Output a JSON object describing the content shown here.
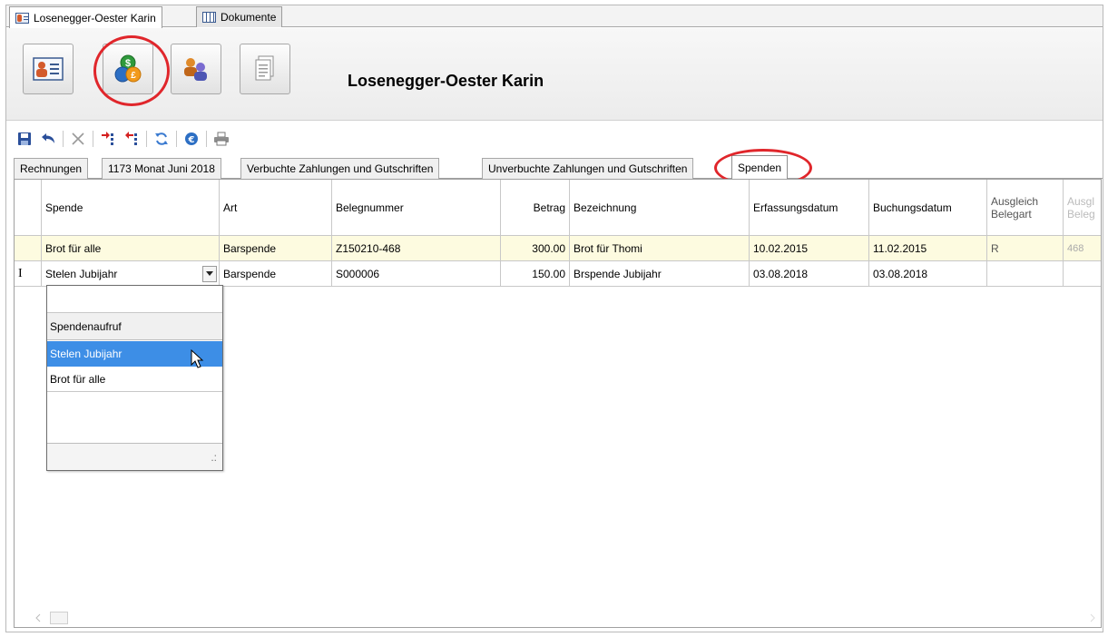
{
  "top_tabs": [
    {
      "label": "Losenegger-Oester Karin",
      "icon": "person-card-icon",
      "active": true
    },
    {
      "label": "Dokumente",
      "icon": "grid-icon",
      "active": false
    }
  ],
  "header": {
    "title": "Losenegger-Oester Karin",
    "buttons": [
      {
        "name": "person-details-button",
        "icon": "person-card-icon"
      },
      {
        "name": "finance-button",
        "icon": "money-bag-icon",
        "highlighted": true
      },
      {
        "name": "relations-button",
        "icon": "people-icon"
      },
      {
        "name": "documents-button",
        "icon": "document-icon"
      }
    ]
  },
  "toolbar": {
    "icons": [
      "save-icon",
      "undo-icon",
      "delete-icon",
      "move-up-icon",
      "move-down-icon",
      "refresh-icon",
      "euro-icon",
      "print-icon"
    ]
  },
  "sub_tabs": [
    {
      "label": "Rechnungen"
    },
    {
      "label": "1173 Monat Juni 2018"
    },
    {
      "label": "Verbuchte Zahlungen und Gutschriften"
    },
    {
      "label": "Unverbuchte Zahlungen und Gutschriften"
    },
    {
      "label": "Spenden",
      "active": true
    }
  ],
  "table": {
    "headers": {
      "spende": "Spende",
      "art": "Art",
      "belegnummer": "Belegnummer",
      "betrag": "Betrag",
      "bezeichnung": "Bezeichnung",
      "erfassungsdatum": "Erfassungsdatum",
      "buchungsdatum": "Buchungsdatum",
      "ausgleich_belegart_1": "Ausgleich",
      "ausgleich_belegart_2": "Belegart",
      "ausgleich_belegnr_1": "Ausgl",
      "ausgleich_belegnr_2": "Beleg"
    },
    "rows": [
      {
        "spende": "Brot für alle",
        "art": "Barspende",
        "belegnummer": "Z150210-468",
        "betrag": "300.00",
        "bezeichnung": "Brot für Thomi",
        "erfassungsdatum": "10.02.2015",
        "buchungsdatum": "11.02.2015",
        "ausgleich_belegart": "R",
        "ausgleich_belegnr": "468"
      },
      {
        "spende": "Stelen Jubijahr",
        "art": "Barspende",
        "belegnummer": "S000006",
        "betrag": "150.00",
        "bezeichnung": "Brspende Jubijahr",
        "erfassungsdatum": "03.08.2018",
        "buchungsdatum": "03.08.2018",
        "ausgleich_belegart": "",
        "ausgleich_belegnr": ""
      }
    ],
    "row_indicator": "I"
  },
  "dropdown": {
    "header": "Spendenaufruf",
    "options": [
      {
        "label": "Stelen Jubijahr",
        "selected": true
      },
      {
        "label": "Brot für alle",
        "selected": false
      }
    ],
    "resize_grip": ".:"
  },
  "colors": {
    "highlight_ring": "#e0262b",
    "selected_row": "#fdfbe0",
    "selected_option": "#3d8ee6"
  }
}
